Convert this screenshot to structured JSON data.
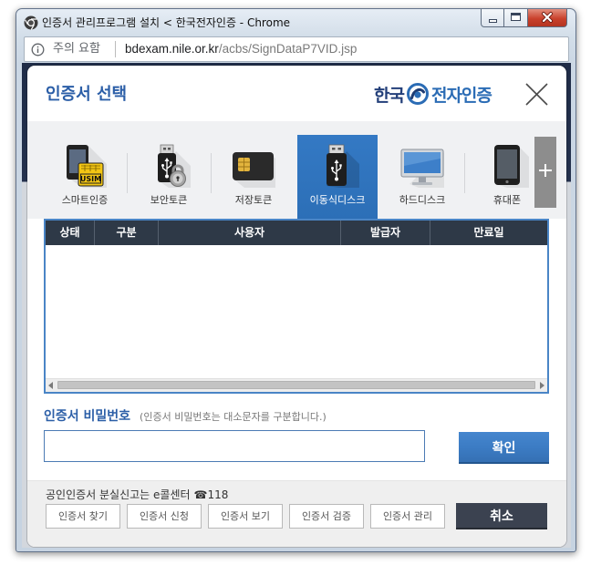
{
  "window": {
    "title": "인증서 관리프로그램 설치 < 한국전자인증 - Chrome",
    "icon": "chrome-icon",
    "controls": [
      "minimize-icon",
      "maximize-icon",
      "close-icon"
    ]
  },
  "address_bar": {
    "security_icon": "info-icon",
    "security_label": "주의 요함",
    "host": "bdexam.nile.or.kr",
    "path": "/acbs/SignDataP7VID.jsp"
  },
  "dialog": {
    "title": "인증서 선택",
    "logo": {
      "left": "한국",
      "right": "전자인증",
      "emblem_icon": "logo-emblem-icon"
    },
    "close_icon": "close-icon",
    "media": [
      {
        "label": "스마트인증",
        "icon": "smart-usim-icon",
        "selected": false
      },
      {
        "label": "보안토큰",
        "icon": "secure-token-icon",
        "selected": false
      },
      {
        "label": "저장토큰",
        "icon": "storage-token-icon",
        "selected": false
      },
      {
        "label": "이동식디스크",
        "icon": "usb-drive-icon",
        "selected": true
      },
      {
        "label": "하드디스크",
        "icon": "hard-disk-icon",
        "selected": false
      },
      {
        "label": "휴대폰",
        "icon": "mobile-phone-icon",
        "selected": false
      }
    ],
    "usim_card_text": "USIM",
    "media_more_icon": "plus-icon",
    "table": {
      "columns": [
        "상태",
        "구분",
        "사용자",
        "발급자",
        "만료일"
      ],
      "rows": []
    },
    "password": {
      "label": "인증서 비밀번호",
      "hint": "(인증서 비밀번호는 대소문자를 구분합니다.)",
      "value": ""
    },
    "confirm_label": "확인",
    "notice": {
      "text": "공인인증서 분실신고는 e콜센터",
      "phone_icon": "phone-icon",
      "phone": "118"
    },
    "actions": [
      "인증서 찾기",
      "인증서 신청",
      "인증서 보기",
      "인증서 검증",
      "인증서 관리"
    ],
    "cancel_label": "취소"
  },
  "colors": {
    "accent": "#2b5ea7",
    "tab_selected": "#2c6fb7",
    "table_header": "#2e3947",
    "table_border": "#4a85c6",
    "confirm": "#3c7cc4",
    "cancel": "#3b4250",
    "close_button": "#c9412c"
  }
}
